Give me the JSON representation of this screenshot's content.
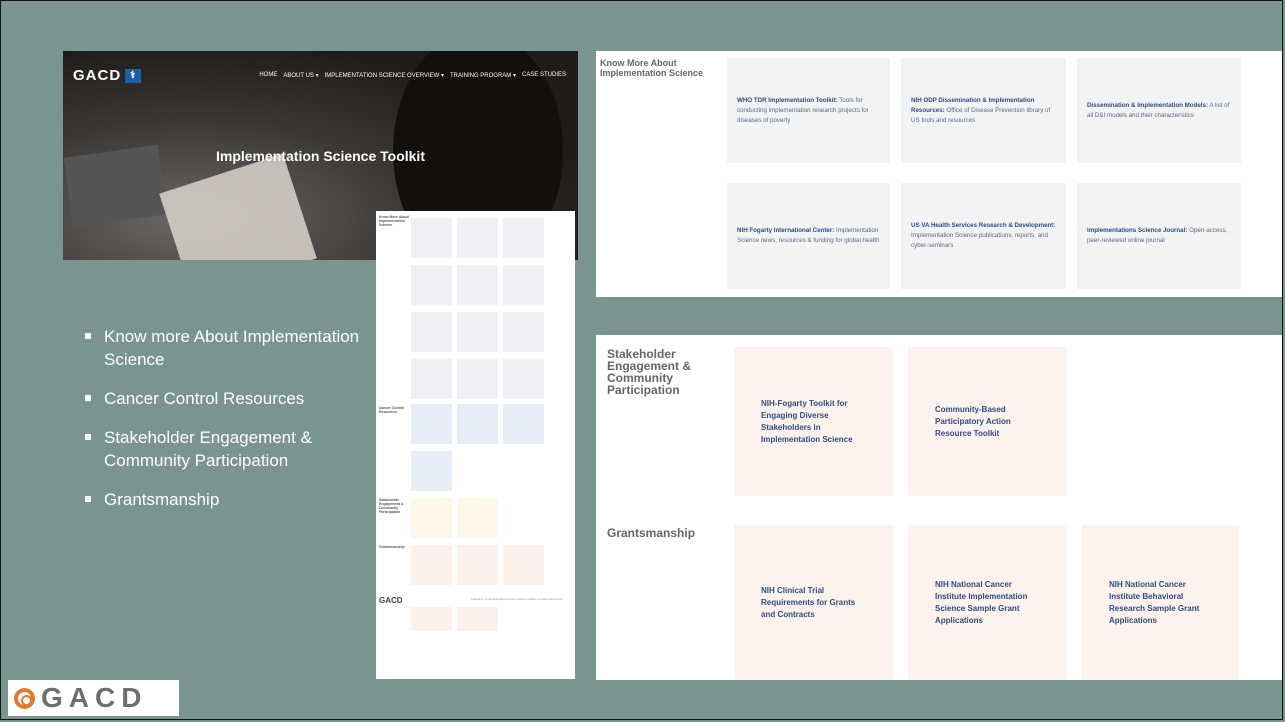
{
  "hero": {
    "logo_text": "GACD",
    "logo_badge": "⚕",
    "nav": [
      "HOME",
      "ABOUT US ▾",
      "IMPLEMENTATION SCIENCE OVERVIEW ▾",
      "TRAINING PROGRAM ▾",
      "CASE STUDIES"
    ],
    "title": "Implementation Science Toolkit"
  },
  "thumbnail": {
    "sections": [
      "Know More About Implementation Science",
      "Cancer Control Resources",
      "Stakeholder Engagement & Community Participation",
      "Grantsmanship"
    ],
    "footer_logo": "GACD",
    "footer_nav": "HOME  ABOUT US  IMPLEMENTATION SCIENCE OVERVIEW  TRAINING PROGRAM  CASE STUDIES"
  },
  "bullets": [
    "Know more About Implementation Science",
    "Cancer Control Resources",
    "Stakeholder Engagement & Community Participation",
    "Grantsmanship"
  ],
  "know_more": {
    "label": "Know More About Implementation Science",
    "cards": [
      {
        "bold": "WHO TDR Implementation Toolkit:",
        "text": " Tools for conducting implementation research projects for diseases of poverty"
      },
      {
        "bold": "NIH ODP Dissemination & Implementation Resources:",
        "text": " Office of Disease Prevention library of US tools and resources"
      },
      {
        "bold": "Dissemination & Implementation Models:",
        "text": " A list of all D&I models and their characteristics"
      },
      {
        "bold": "NIH Fogarty International Center:",
        "text": " Implementation Science news, resources & funding for global health"
      },
      {
        "bold": "US VA Health Services Research & Development:",
        "text": " Implementation Science publications, reports, and cyber-seminars"
      },
      {
        "bold": "Implementations Science Journal:",
        "text": " Open-access, peer-reviewed online journal"
      }
    ]
  },
  "stakeholder": {
    "label": "Stakeholder Engagement & Community Participation",
    "cards": [
      "NIH-Fogarty Toolkit for Engaging Diverse Stakeholders in Implementation Science",
      "Community-Based Participatory Action Resource Toolkit"
    ]
  },
  "grants": {
    "label": "Grantsmanship",
    "cards": [
      "NIH Clinical Trial Requirements for Grants and Contracts",
      "NIH National Cancer Institute Implementation Science Sample Grant Applications",
      "NIH National Cancer Institute Behavioral Research Sample Grant Applications"
    ]
  },
  "bottom_logo": "GACD",
  "colors": {
    "background": "#7a9490",
    "accent_blue": "#2f4b80",
    "pink_card": "#fdf2ee",
    "orange_logo": "#e07a30"
  }
}
